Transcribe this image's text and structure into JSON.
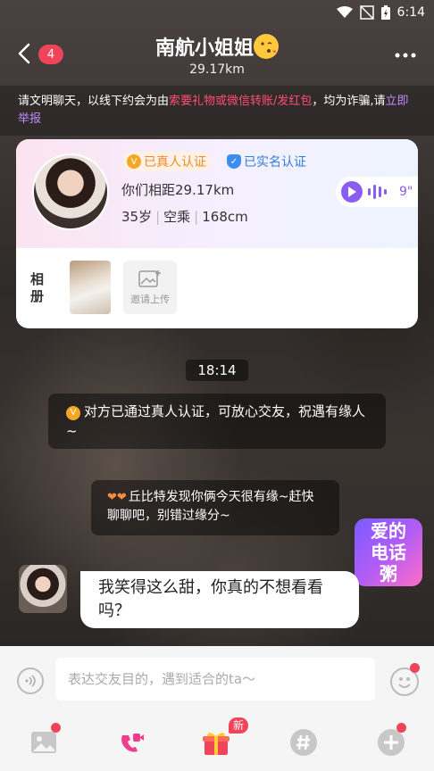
{
  "status_bar": {
    "time": "6:14"
  },
  "header": {
    "unread_count": "4",
    "title": "南航小姐姐",
    "distance": "29.17km"
  },
  "notice": {
    "prefix": "请文明聊天，以线下约会为由",
    "warning": "索要礼物或微信转账/发红包",
    "middle": "，均为诈骗,请",
    "report_link": "立即举报"
  },
  "profile_card": {
    "badge_real": "已真人认证",
    "badge_name": "已实名认证",
    "distance_text": "你们相距29.17km",
    "age": "35岁",
    "job": "空乘",
    "height": "168cm",
    "voice_length": "9\"",
    "album_label": "相册",
    "invite_upload_label": "邀请上传"
  },
  "chat": {
    "time_divider": "18:14",
    "system_verified": "对方已通过真人认证，可放心交友，祝遇有缘人~",
    "system_cupid": "丘比特发现你俩今天很有缘~赶快聊聊吧，别错过缘分~",
    "message_text": "我笑得这么甜，你真的不想看看吗？",
    "promo_text": "爱的电话粥"
  },
  "input": {
    "placeholder": "表达交友目的，遇到适合的ta～"
  },
  "toolbar": {
    "gift_badge": "新"
  },
  "colors": {
    "accent_red": "#f0445a",
    "accent_purple": "#8a5cf0",
    "warning_pink": "#ff4d73",
    "real_badge_orange": "#f08a2a",
    "name_badge_blue": "#2f7fe0"
  }
}
